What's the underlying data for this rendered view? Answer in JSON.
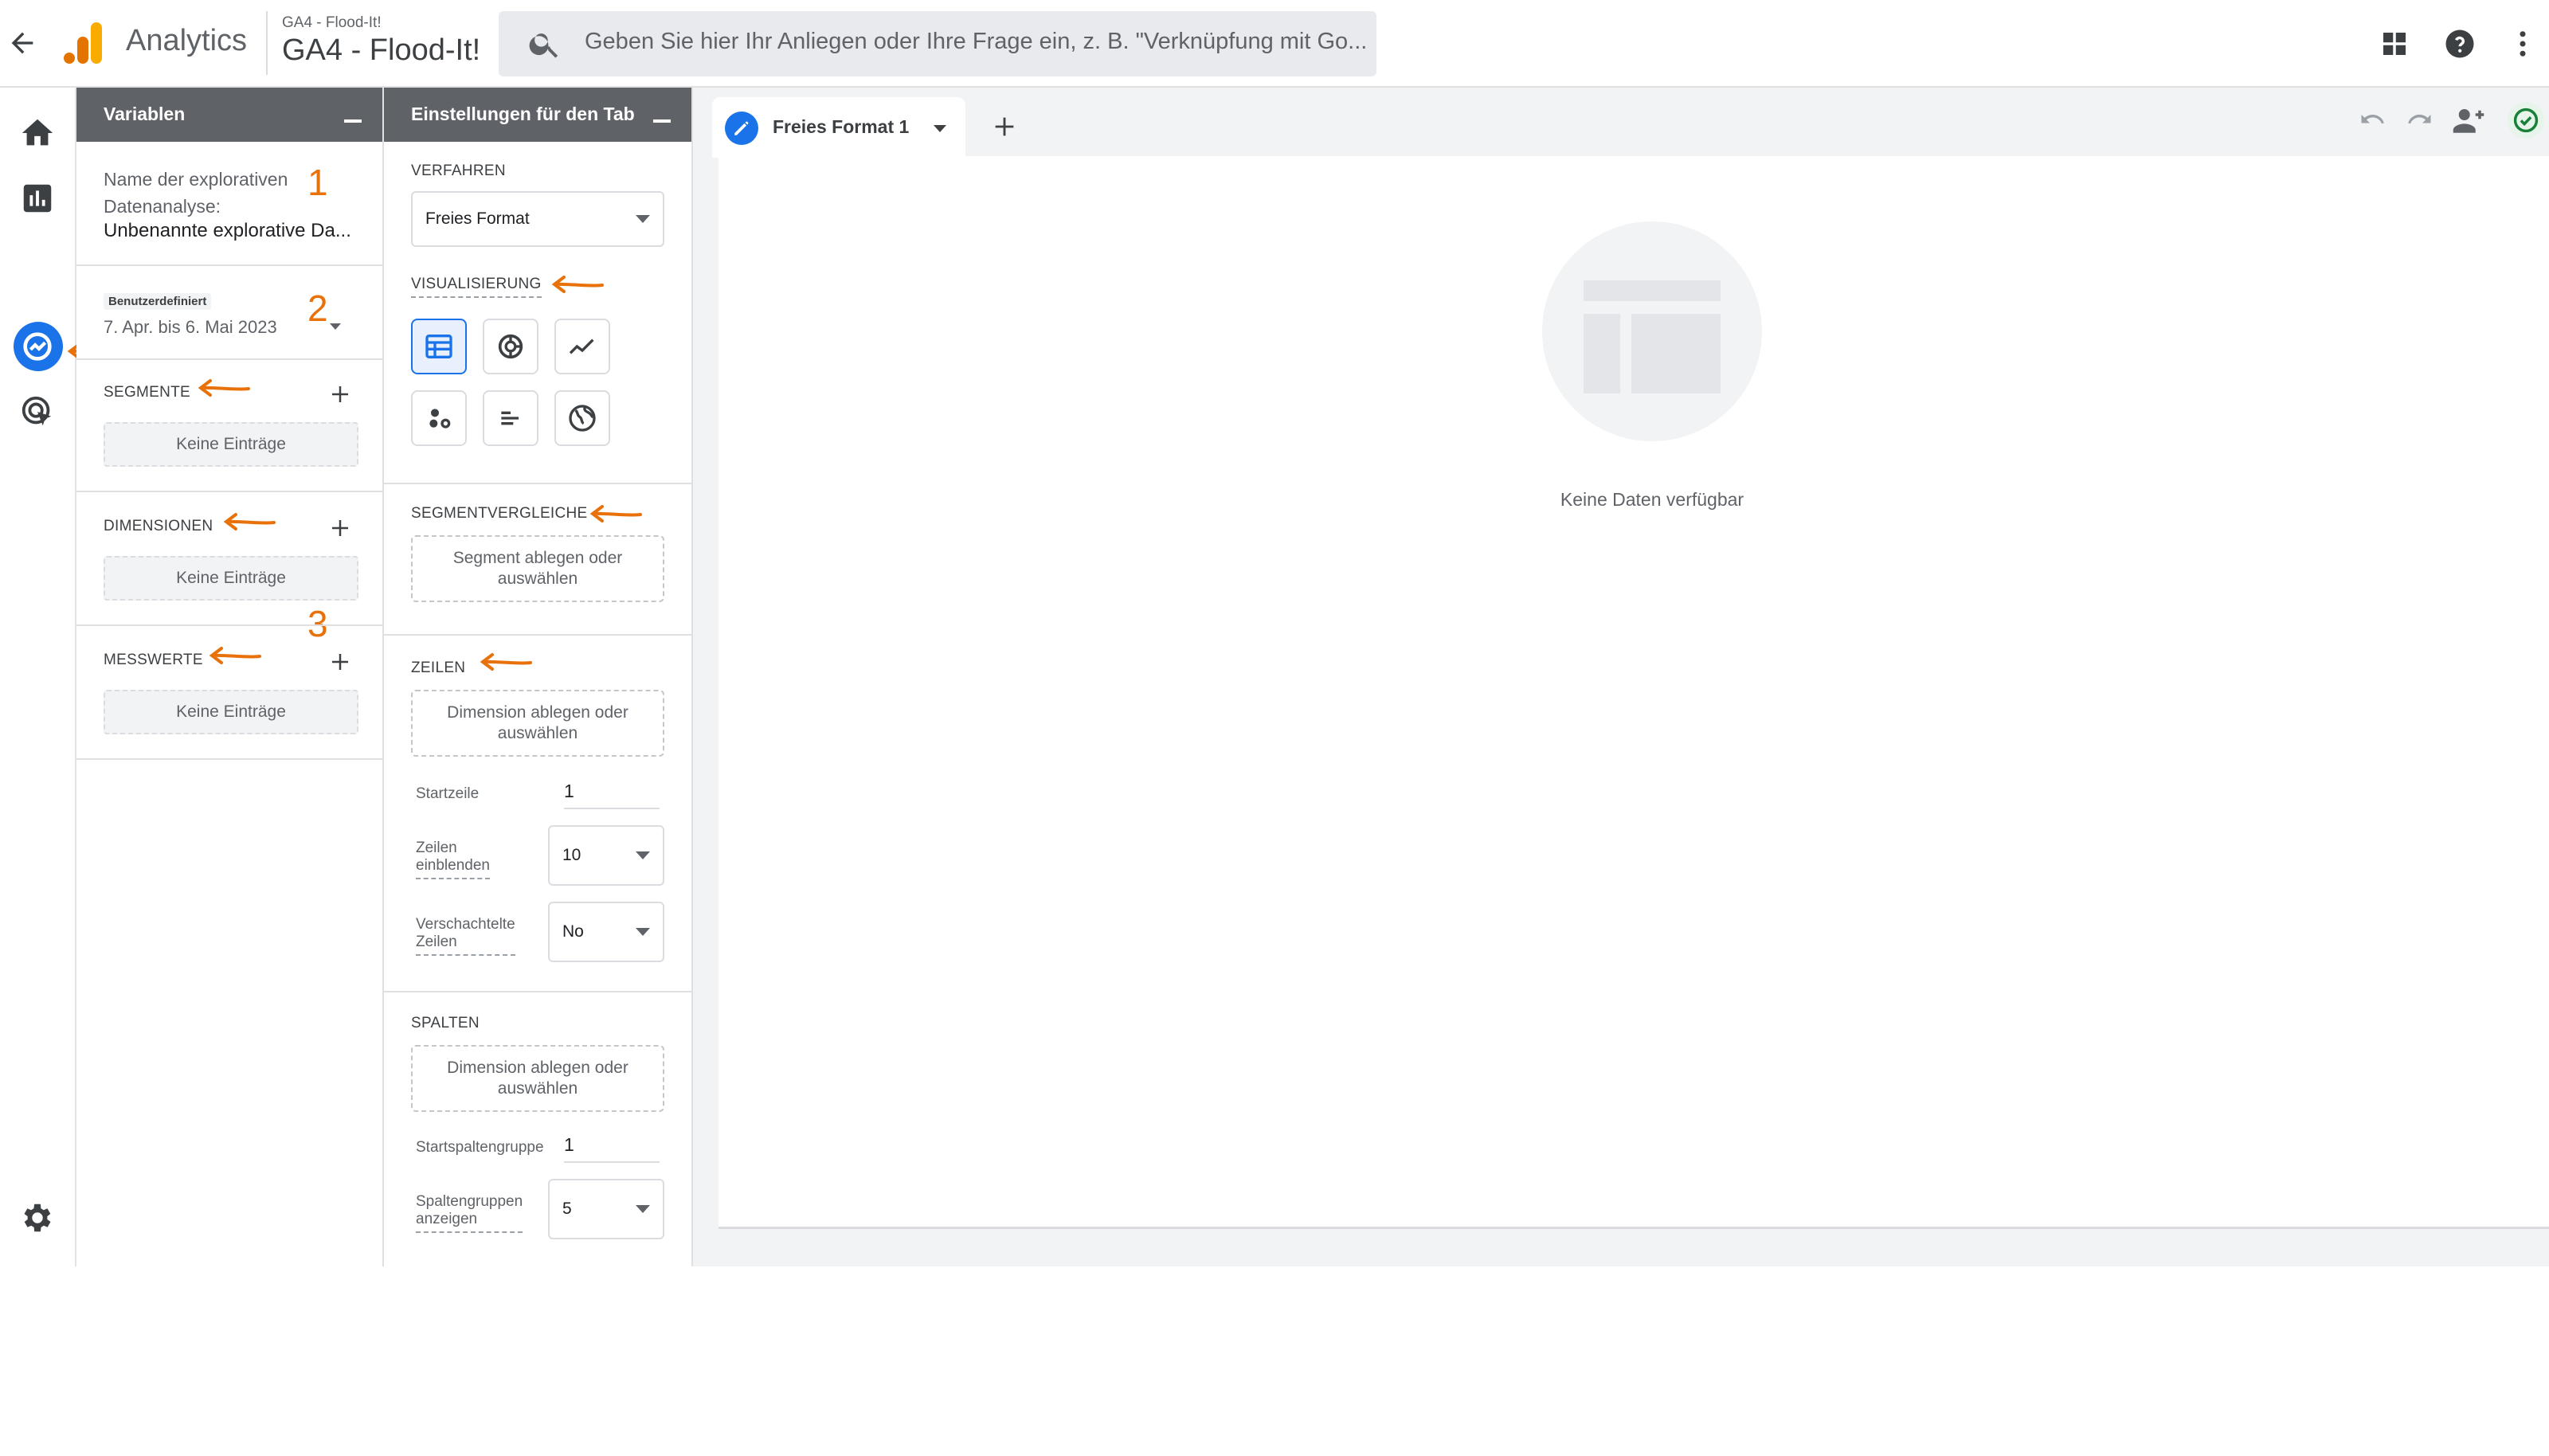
{
  "header": {
    "app_name": "Analytics",
    "property_account": "GA4 - Flood-It!",
    "property_name": "GA4 - Flood-It!",
    "search_placeholder": "Geben Sie hier Ihr Anliegen oder Ihre Frage ein, z. B. \"Verknüpfung mit Go..."
  },
  "variables_panel": {
    "title": "Variablen",
    "exploration_name_label_line1": "Name der explorativen",
    "exploration_name_label_line2": "Datenanalyse:",
    "exploration_name_value": "Unbenannte explorative Da...",
    "date_badge": "Benutzerdefiniert",
    "date_range": "7. Apr. bis 6. Mai 2023",
    "segments_label": "SEGMENTE",
    "segments_empty": "Keine Einträge",
    "dimensions_label": "DIMENSIONEN",
    "dimensions_empty": "Keine Einträge",
    "metrics_label": "MESSWERTE",
    "metrics_empty": "Keine Einträge"
  },
  "settings_panel": {
    "title": "Einstellungen für den Tab",
    "technique_label": "VERFAHREN",
    "technique_value": "Freies Format",
    "visualization_label": "VISUALISIERUNG",
    "segment_comparisons_label": "SEGMENTVERGLEICHE",
    "segment_drop_line1": "Segment ablegen oder",
    "segment_drop_line2": "auswählen",
    "rows_label": "ZEILEN",
    "rows_drop_line1": "Dimension ablegen oder",
    "rows_drop_line2": "auswählen",
    "start_row_label": "Startzeile",
    "start_row_value": "1",
    "show_rows_label_line1": "Zeilen",
    "show_rows_label_line2": "einblenden",
    "show_rows_value": "10",
    "nested_rows_label_line1": "Verschachtelte",
    "nested_rows_label_line2": "Zeilen",
    "nested_rows_value": "No",
    "columns_label": "SPALTEN",
    "columns_drop_line1": "Dimension ablegen oder",
    "columns_drop_line2": "auswählen",
    "start_col_group_label": "Startspaltengruppe",
    "start_col_group_value": "1",
    "show_col_groups_label_line1": "Spaltengruppen",
    "show_col_groups_label_line2": "anzeigen",
    "show_col_groups_value": "5"
  },
  "canvas": {
    "tab_label": "Freies Format 1",
    "empty_message": "Keine Daten verfügbar"
  },
  "annotations": {
    "n1": "1",
    "n2": "2",
    "n3": "3"
  },
  "icons": {
    "left_nav": [
      "home-icon",
      "reports-icon",
      "explore-icon",
      "advertising-icon",
      "settings-icon"
    ],
    "top_right": [
      "apps-grid-icon",
      "help-icon",
      "more-vert-icon"
    ],
    "canvas_toolbar": [
      "undo-icon",
      "redo-icon",
      "share-icon",
      "saved-check-icon"
    ],
    "visualizations": [
      "table-icon",
      "donut-icon",
      "line-chart-icon",
      "scatter-icon",
      "bar-chart-icon",
      "geo-map-icon"
    ]
  },
  "colors": {
    "accent_blue": "#1a73e8",
    "annotation_orange": "#e8710a",
    "panel_header": "#5f6368"
  }
}
